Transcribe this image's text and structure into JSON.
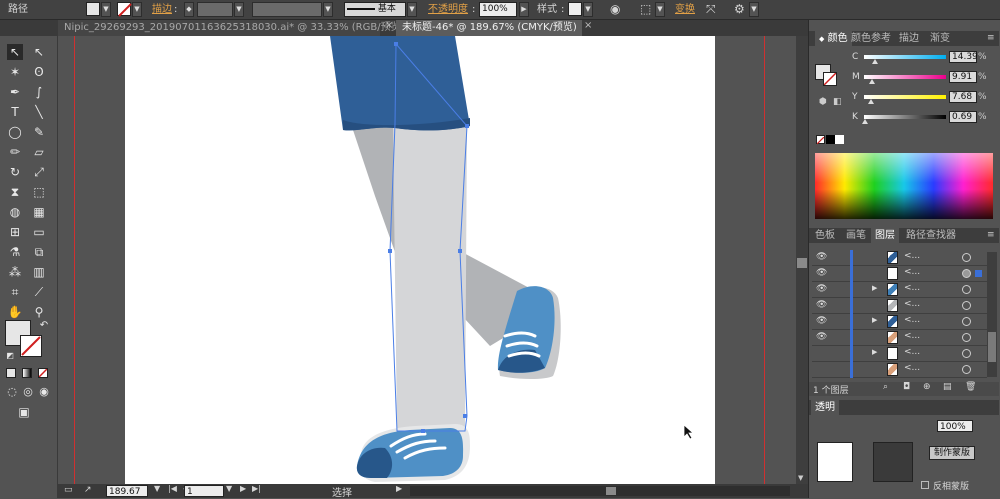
{
  "control_bar": {
    "object_type": "路径",
    "stroke_label": "描边",
    "brush_label": "基本",
    "opacity_label": "不透明度",
    "opacity_value": "100%",
    "style_label": "样式",
    "transform_label": "变换"
  },
  "tabs": [
    {
      "label": "Nipic_29269293_20190701163625318030.ai* @ 33.33% (RGB/预览)"
    },
    {
      "label": "未标题-46* @ 189.67% (CMYK/预览)"
    }
  ],
  "color_panel": {
    "tabs": [
      "颜色",
      "颜色参考",
      "描边",
      "渐变"
    ],
    "channels": [
      {
        "letter": "C",
        "value": "14.39",
        "fraction": 0.14
      },
      {
        "letter": "M",
        "value": "9.91",
        "fraction": 0.1
      },
      {
        "letter": "Y",
        "value": "7.68",
        "fraction": 0.08
      },
      {
        "letter": "K",
        "value": "0.69",
        "fraction": 0.01
      }
    ],
    "percent": "%"
  },
  "layers_panel": {
    "tabs": [
      "色板",
      "画笔",
      "图层",
      "路径查找器"
    ],
    "rows": [
      {
        "name": "<...",
        "expand": false,
        "thumb": "#2f5f97"
      },
      {
        "name": "<...",
        "expand": false,
        "thumb": "#ffffff"
      },
      {
        "name": "<...",
        "expand": true,
        "thumb": "#3f80b8"
      },
      {
        "name": "<...",
        "expand": false,
        "thumb": "#b4b6b8"
      },
      {
        "name": "<...",
        "expand": true,
        "thumb": "#2f5f97"
      },
      {
        "name": "<...",
        "expand": false,
        "thumb": "#d9a07a"
      },
      {
        "name": "<...",
        "expand": true,
        "thumb": "#ffffff"
      },
      {
        "name": "<...",
        "expand": false,
        "thumb": "#d9a07a"
      }
    ],
    "footer_text": "1 个图层"
  },
  "transparency_panel": {
    "tab": "透明",
    "opacity_value": "100%",
    "make_mask": "制作蒙版",
    "invert_mask": "反相蒙版"
  },
  "status_bar": {
    "zoom": "189.67",
    "page": "1",
    "tool": "选择"
  },
  "colors": {
    "jeans": "#2f5f97",
    "jeans_dark": "#264f80",
    "leg_light": "#d5d6d8",
    "leg_dark": "#b1b3b6",
    "shoe_light": "#4f90c6",
    "shoe_dark": "#27578a",
    "selection": "#4a7ee6",
    "guide": "#d03030"
  }
}
